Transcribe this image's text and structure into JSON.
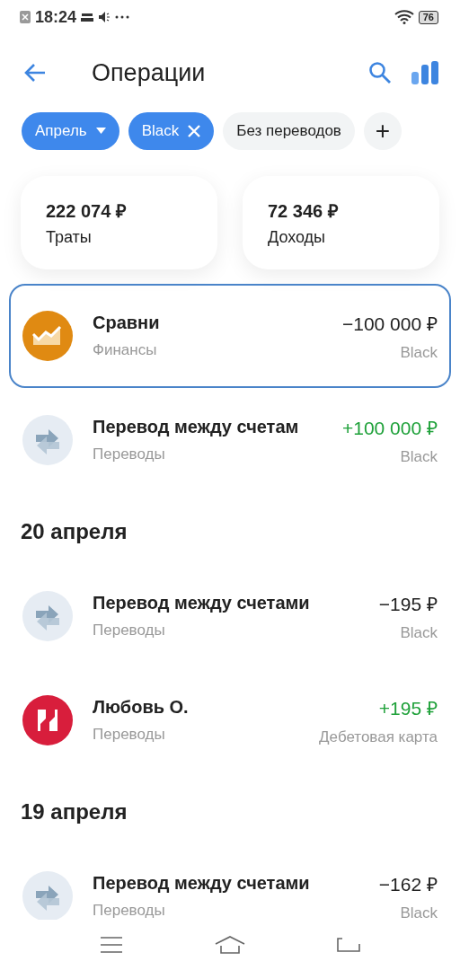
{
  "status_bar": {
    "time": "18:24",
    "battery": "76"
  },
  "header": {
    "title": "Операции"
  },
  "filters": [
    {
      "label": "Апрель",
      "kind": "dropdown",
      "selected": true
    },
    {
      "label": "Black",
      "kind": "removable",
      "selected": true
    },
    {
      "label": "Без переводов",
      "kind": "plain",
      "selected": false
    }
  ],
  "add_filter": "+",
  "summary": [
    {
      "amount": "222 074 ₽",
      "label": "Траты"
    },
    {
      "amount": "72 346 ₽",
      "label": "Доходы"
    }
  ],
  "groups": [
    {
      "items": [
        {
          "kind": "chart",
          "title": "Сравни",
          "category": "Финансы",
          "amount": "−100 000 ₽",
          "income": false,
          "account": "Black",
          "selected": true
        },
        {
          "kind": "transfer",
          "title": "Перевод между счетам",
          "category": "Переводы",
          "amount": "+100 000 ₽",
          "income": true,
          "account": "Black",
          "selected": false
        }
      ]
    },
    {
      "date": "20 апреля",
      "items": [
        {
          "kind": "transfer",
          "title": "Перевод между счетами",
          "category": "Переводы",
          "amount": "−195 ₽",
          "income": false,
          "account": "Black",
          "selected": false
        },
        {
          "kind": "logo",
          "title": "Любовь О.",
          "category": "Переводы",
          "amount": "+195 ₽",
          "income": true,
          "account": "Дебетовая карта",
          "selected": false
        }
      ]
    },
    {
      "date": "19 апреля",
      "items": [
        {
          "kind": "transfer",
          "title": "Перевод между счетами",
          "category": "Переводы",
          "amount": "−162 ₽",
          "income": false,
          "account": "Black",
          "selected": false
        }
      ]
    }
  ]
}
